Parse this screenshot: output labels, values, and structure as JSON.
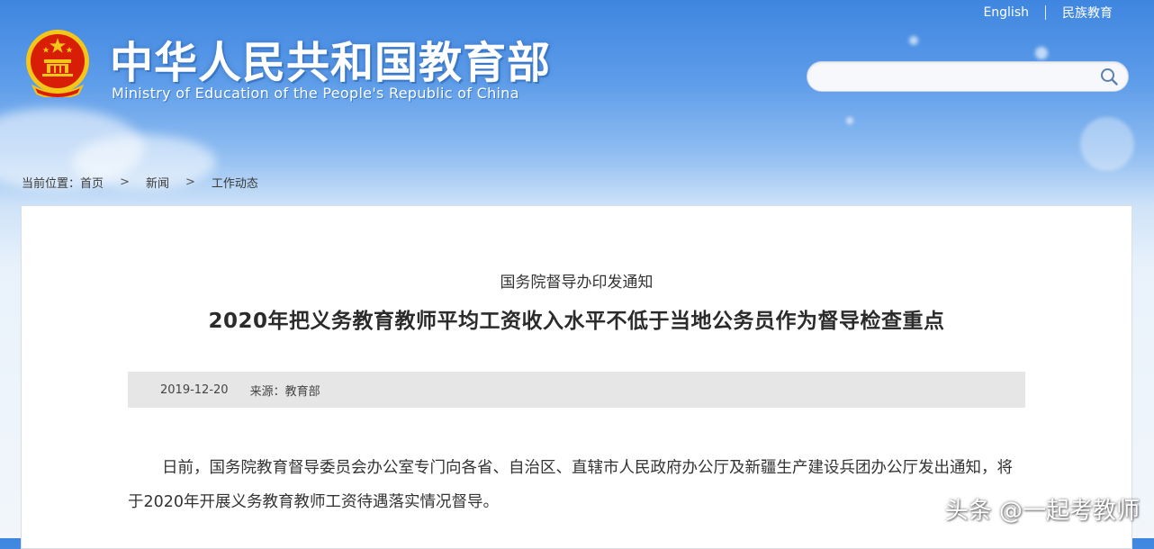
{
  "header": {
    "title": "中华人民共和国教育部",
    "subtitle": "Ministry of Education of the People's Republic of China",
    "links": [
      "English",
      "民族教育"
    ],
    "search": {
      "placeholder": "",
      "value": ""
    }
  },
  "breadcrumb": {
    "prefix": "当前位置：",
    "items": [
      "首页",
      "新闻",
      "工作动态"
    ],
    "separator": ">"
  },
  "article": {
    "kicker": "国务院督导办印发通知",
    "headline": "2020年把义务教育教师平均工资收入水平不低于当地公务员作为督导检查重点",
    "date": "2019-12-20",
    "source": "来源：教育部",
    "body": "日前，国务院教育督导委员会办公室专门向各省、自治区、直辖市人民政府办公厅及新疆生产建设兵团办公厅发出通知，将于2020年开展义务教育教师工资待遇落实情况督导。"
  },
  "watermark": "头条 @一起考教师",
  "colors": {
    "header_blue": "#3f86e0",
    "emblem_red": "#d81e06",
    "emblem_gold": "#f5c518"
  },
  "icons": [
    "national-emblem-icon",
    "search-icon"
  ]
}
